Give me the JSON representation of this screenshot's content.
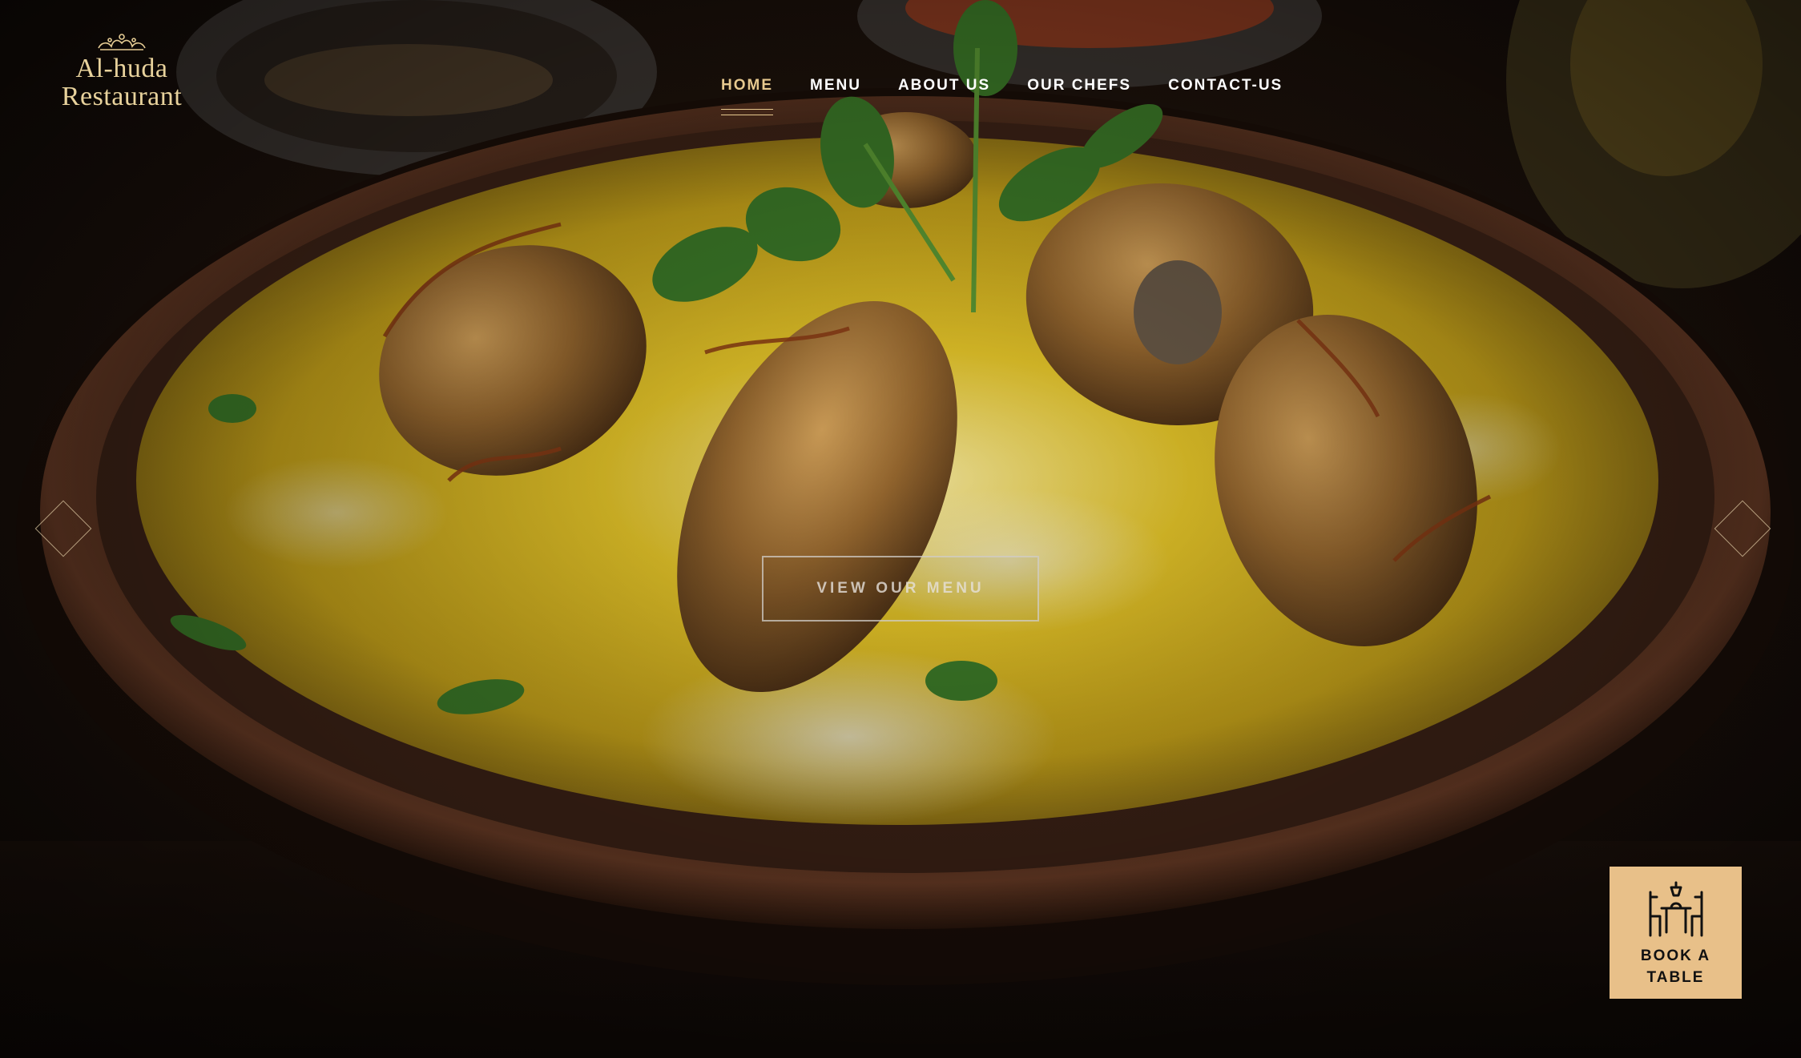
{
  "brand": {
    "line1": "Al-huda",
    "line2": "Restaurant",
    "color": "#e8d29c"
  },
  "nav": {
    "items": [
      {
        "label": "HOME",
        "active": true
      },
      {
        "label": "MENU",
        "active": false
      },
      {
        "label": "ABOUT US",
        "active": false
      },
      {
        "label": "OUR CHEFS",
        "active": false
      },
      {
        "label": "CONTACT-US",
        "active": false
      }
    ],
    "active_color": "#e6c88e"
  },
  "hero": {
    "cta_label": "VIEW OUR MENU",
    "prev_icon": "chevron-left-diamond-icon",
    "next_icon": "chevron-right-diamond-icon"
  },
  "booking": {
    "label": "BOOK A TABLE",
    "icon": "dining-table-icon",
    "background": "#e8c089"
  }
}
